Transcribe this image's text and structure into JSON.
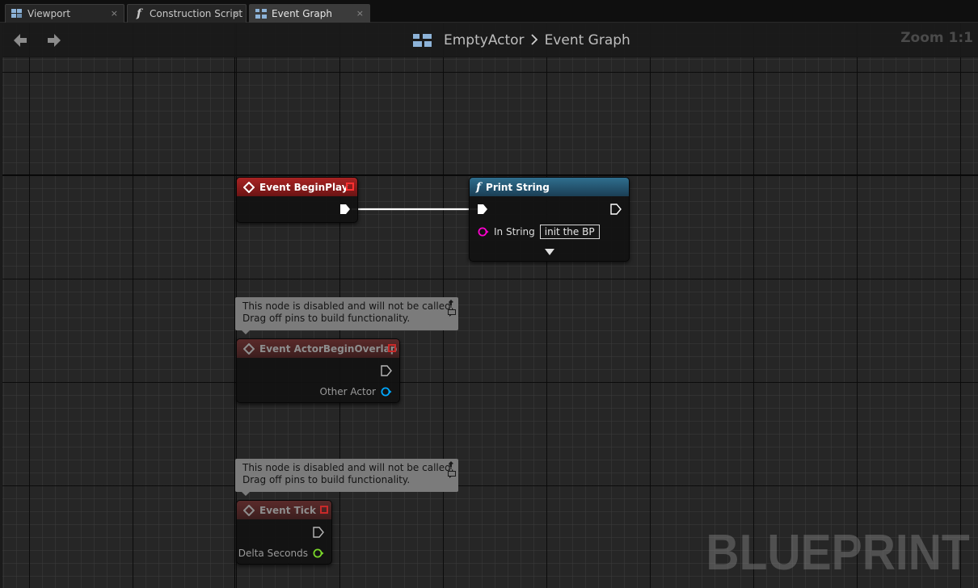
{
  "tabs": [
    {
      "label": "Viewport",
      "icon": "viewport-icon",
      "active": false
    },
    {
      "label": "Construction Script",
      "icon": "function-icon",
      "active": false
    },
    {
      "label": "Event Graph",
      "icon": "event-graph-icon",
      "active": true
    }
  ],
  "tab_close_glyph": "×",
  "header": {
    "breadcrumb_parent": "EmptyActor",
    "breadcrumb_current": "Event Graph",
    "zoom": "Zoom 1:1"
  },
  "nodes": {
    "begin_play": {
      "title": "Event BeginPlay"
    },
    "print_string": {
      "title": "Print String",
      "in_string_label": "In String",
      "in_string_value": "init the BP"
    },
    "actor_begin_overlap": {
      "title": "Event ActorBeginOverlap",
      "output_label": "Other Actor",
      "disabled": true
    },
    "tick": {
      "title": "Event Tick",
      "output_label": "Delta Seconds",
      "disabled": true
    }
  },
  "disabled_note": {
    "line1": "This node is disabled and will not be called.",
    "line2": "Drag off pins to build functionality."
  },
  "watermark": "BLUEPRINT",
  "colors": {
    "event_header": "#a82323",
    "function_header": "#2f6e8e",
    "string_pin": "#ff00d0",
    "object_pin": "#00a8ff",
    "float_pin": "#7bd82a",
    "exec_wire": "#ffffff"
  }
}
